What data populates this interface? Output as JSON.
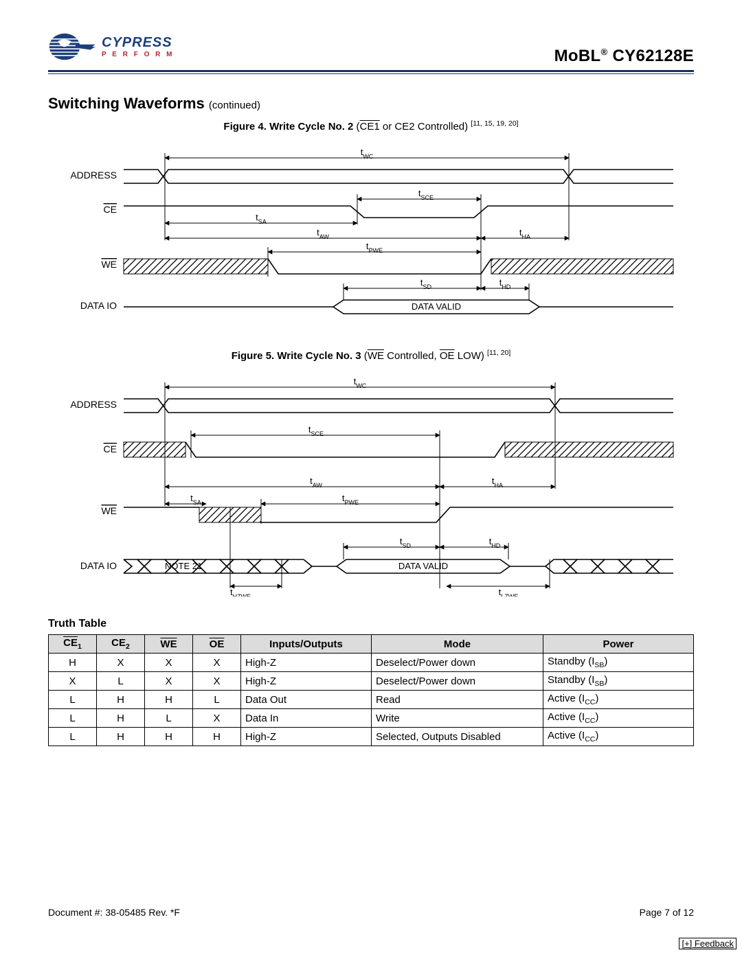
{
  "header": {
    "brand_main": "CYPRESS",
    "brand_sub": "P E R F O R M",
    "product_prefix": "MoBL",
    "product_suffix": "CY62128E"
  },
  "section": {
    "title": "Switching Waveforms",
    "continued": "(continued)"
  },
  "fig4": {
    "prefix": "Figure 4.  Write Cycle No. 2",
    "ctl_pre": " (",
    "ctl_ov": "CE1",
    "ctl_post": " or CE2 Controlled) ",
    "refs": "[11, 15, 19, 20]",
    "sig_address": "ADDRESS",
    "sig_ce": "CE",
    "sig_we": "WE",
    "sig_dataio": "DATA  IO",
    "t_wc": "WC",
    "t_sce": "SCE",
    "t_sa": "SA",
    "t_aw": "AW",
    "t_ha": "HA",
    "t_pwe": "PWE",
    "t_sd": "SD",
    "t_hd": "HD",
    "data_valid": "DATA VALID"
  },
  "fig5": {
    "prefix": "Figure 5.  Write Cycle No. 3",
    "ctl_pre": " (",
    "ctl_ov1": "WE",
    "ctl_mid": " Controlled, ",
    "ctl_ov2": "OE",
    "ctl_post": " LOW) ",
    "refs": "[11, 20]",
    "sig_address": "ADDRESS",
    "sig_ce": "CE",
    "sig_we": "WE",
    "sig_dataio": "DATA  IO",
    "t_wc": "WC",
    "t_sce": "SCE",
    "t_sa": "SA",
    "t_aw": "AW",
    "t_ha": "HA",
    "t_pwe": "PWE",
    "t_sd": "SD",
    "t_hd": "HD",
    "t_hzwe": "HZWE",
    "t_lzwe": "LZWE",
    "note21": "NOTE 21",
    "data_valid": "DATA VALID"
  },
  "truth": {
    "title": "Truth Table",
    "headers": [
      "CE",
      "1",
      "CE",
      "2",
      "WE",
      "OE",
      "Inputs/Outputs",
      "Mode",
      "Power"
    ],
    "rows": [
      {
        "ce1": "H",
        "ce2": "X",
        "we": "X",
        "oe": "X",
        "io": "High-Z",
        "mode": "Deselect/Power down",
        "power_pre": "Standby (I",
        "power_sub": "SB",
        "power_post": ")"
      },
      {
        "ce1": "X",
        "ce2": "L",
        "we": "X",
        "oe": "X",
        "io": "High-Z",
        "mode": "Deselect/Power down",
        "power_pre": "Standby (I",
        "power_sub": "SB",
        "power_post": ")"
      },
      {
        "ce1": "L",
        "ce2": "H",
        "we": "H",
        "oe": "L",
        "io": "Data Out",
        "mode": "Read",
        "power_pre": "Active (I",
        "power_sub": "CC",
        "power_post": ")"
      },
      {
        "ce1": "L",
        "ce2": "H",
        "we": "L",
        "oe": "X",
        "io": "Data In",
        "mode": "Write",
        "power_pre": "Active (I",
        "power_sub": "CC",
        "power_post": ")"
      },
      {
        "ce1": "L",
        "ce2": "H",
        "we": "H",
        "oe": "H",
        "io": "High-Z",
        "mode": "Selected, Outputs Disabled",
        "power_pre": "Active (I",
        "power_sub": "CC",
        "power_post": ")"
      }
    ]
  },
  "footer": {
    "doc": "Document #: 38-05485 Rev. *F",
    "page": "Page 7 of 12",
    "feedback": "[+] Feedback"
  }
}
